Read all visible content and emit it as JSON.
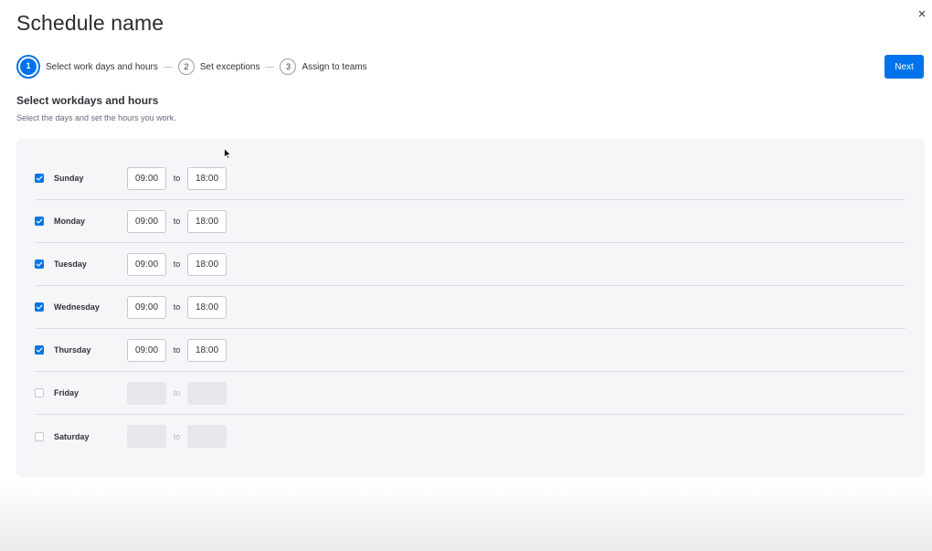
{
  "header": {
    "title": "Schedule name",
    "close_icon": "×"
  },
  "stepper": {
    "steps": [
      {
        "number": "1",
        "label": "Select work days and hours",
        "active": true
      },
      {
        "number": "2",
        "label": "Set exceptions",
        "active": false
      },
      {
        "number": "3",
        "label": "Assign to teams",
        "active": false
      }
    ]
  },
  "actions": {
    "next_label": "Next"
  },
  "section": {
    "title": "Select workdays and hours",
    "subtitle": "Select the days and set the hours you work."
  },
  "separator_label": "to",
  "days": [
    {
      "label": "Sunday",
      "checked": true,
      "start": "09:00",
      "end": "18:00"
    },
    {
      "label": "Monday",
      "checked": true,
      "start": "09:00",
      "end": "18:00"
    },
    {
      "label": "Tuesday",
      "checked": true,
      "start": "09:00",
      "end": "18:00"
    },
    {
      "label": "Wednesday",
      "checked": true,
      "start": "09:00",
      "end": "18:00"
    },
    {
      "label": "Thursday",
      "checked": true,
      "start": "09:00",
      "end": "18:00"
    },
    {
      "label": "Friday",
      "checked": false,
      "start": "",
      "end": ""
    },
    {
      "label": "Saturday",
      "checked": false,
      "start": "",
      "end": ""
    }
  ],
  "colors": {
    "accent": "#0073ea",
    "panel": "#f5f6f8",
    "text": "#323338"
  },
  "icons": {
    "close": "close-icon",
    "check": "checkmark-icon",
    "cursor": "mouse-cursor-icon"
  }
}
